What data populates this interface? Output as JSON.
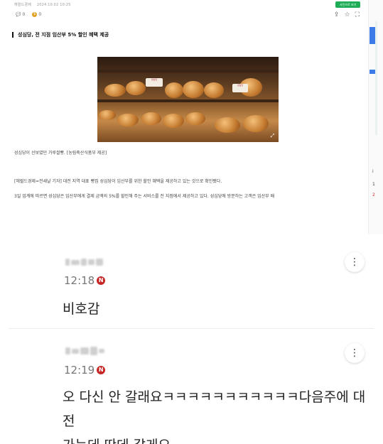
{
  "article": {
    "meta": {
      "source": "헤럴드경제",
      "datetime": "2024.10.02 10:25"
    },
    "green_button": "사진으로 보기",
    "reactions": {
      "comments": "0",
      "coins": "0"
    },
    "headline": "성심당, 전 지점 임산부 5% 할인 혜택 제공",
    "photo_alt": "빵 진열대 사진",
    "photo_tags": [
      "성심당",
      "성심당"
    ],
    "caption": "성심당이 선보였던 가루쌀빵. [농림축산식품부 제공]",
    "paragraph1": "[헤럴드경제=전새날 기자] 대전 지역 대표 빵집 성심당이 임산부를 위한 할인 혜택을 제공하고 있는 것으로 확인됐다.",
    "paragraph2": "3일 업계에 따르면 성심당은 임산부에게 결제 금액의 5%를 할인해 주는 서비스를 전 지점에서 제공하고 있다. 성심당에 방문하는 고객은 임산부 배"
  },
  "sidebar": {
    "items": [
      "1",
      "2",
      "i"
    ]
  },
  "comments": [
    {
      "time": "12:18",
      "badge": "N",
      "text": "비호감"
    },
    {
      "time": "12:19",
      "badge": "N",
      "text": "오 다신 안 갈래요ㅋㅋㅋㅋㅋㅋㅋㅋㅋㅋㅋ다음주에 대전\n가는데 딴데 갈게요"
    }
  ],
  "icons": {
    "more": "more-vertical-icon",
    "share": "share-icon",
    "bookmark": "bookmark-icon",
    "expand": "expand-icon"
  },
  "colors": {
    "accent_green": "#1fae57",
    "badge_red": "#c62828",
    "sidebar_blue": "#3d7be8"
  }
}
